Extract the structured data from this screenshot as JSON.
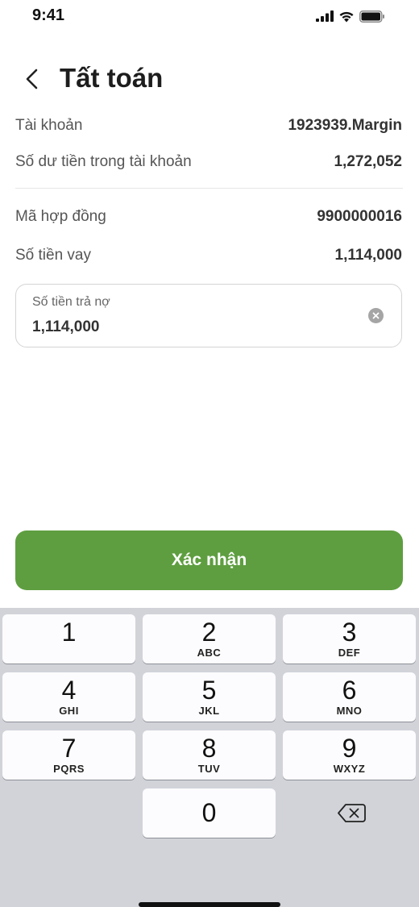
{
  "status_bar": {
    "time": "9:41"
  },
  "header": {
    "title": "Tất toán"
  },
  "info": {
    "account_label": "Tài khoản",
    "account_value": "1923939.Margin",
    "balance_label": "Số dư tiền trong tài khoản",
    "balance_value": "1,272,052",
    "contract_label": "Mã hợp đồng",
    "contract_value": "9900000016",
    "loan_label": "Số tiền vay",
    "loan_value": "1,114,000"
  },
  "repay_input": {
    "label": "Số tiền trả nợ",
    "value": "1,114,000"
  },
  "confirm_button": {
    "label": "Xác nhận"
  },
  "keyboard": {
    "keys": [
      {
        "digit": "1",
        "letters": ""
      },
      {
        "digit": "2",
        "letters": "ABC"
      },
      {
        "digit": "3",
        "letters": "DEF"
      },
      {
        "digit": "4",
        "letters": "GHI"
      },
      {
        "digit": "5",
        "letters": "JKL"
      },
      {
        "digit": "6",
        "letters": "MNO"
      },
      {
        "digit": "7",
        "letters": "PQRS"
      },
      {
        "digit": "8",
        "letters": "TUV"
      },
      {
        "digit": "9",
        "letters": "WXYZ"
      },
      {
        "digit": "0",
        "letters": ""
      }
    ]
  },
  "colors": {
    "accent": "#5e9e40",
    "keyboard_bg": "#d1d3d9"
  }
}
